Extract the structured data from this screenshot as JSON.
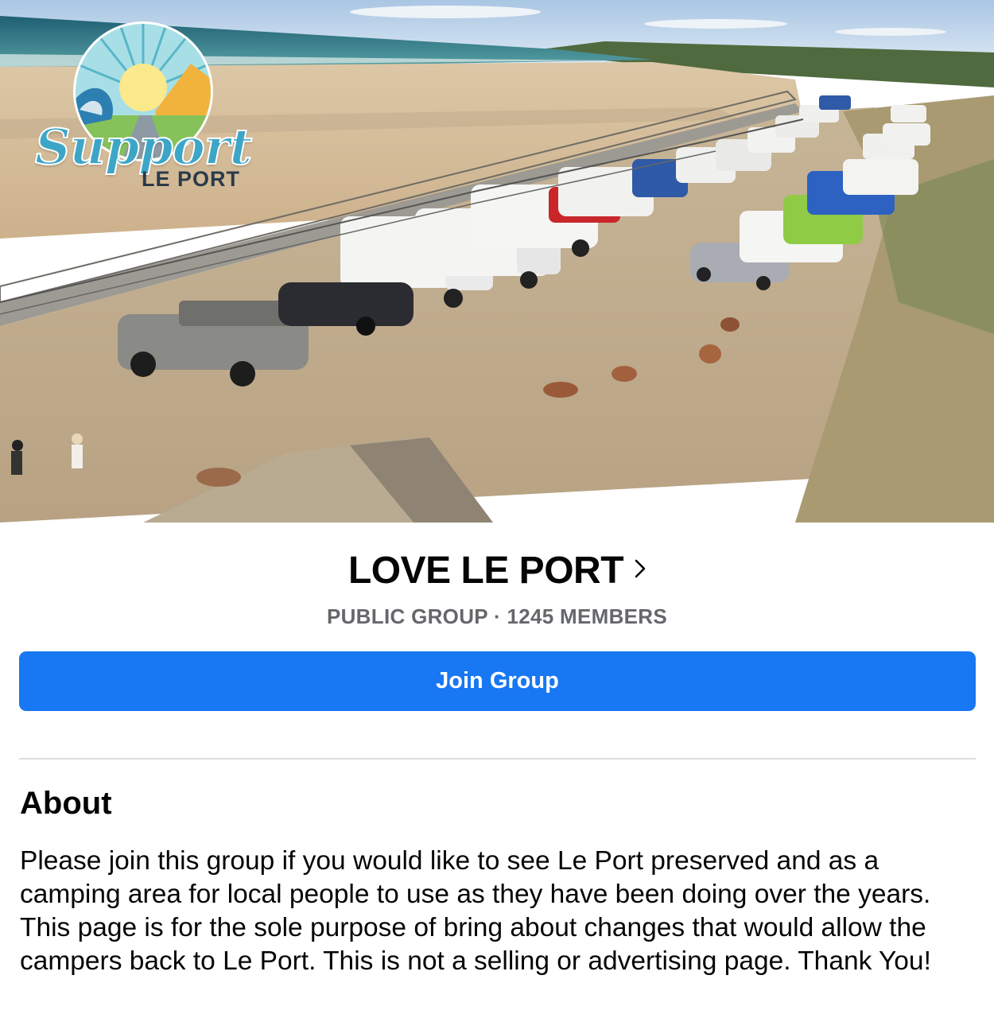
{
  "cover": {
    "logo": {
      "script_text": "Support",
      "sub_text": "LE PORT"
    }
  },
  "group": {
    "name": "LOVE LE PORT",
    "meta": "PUBLIC GROUP · 1245 MEMBERS",
    "join_label": "Join Group"
  },
  "about": {
    "heading": "About",
    "body": "Please join this group if you would like to see Le Port preserved and as a camping area for local people to use as they have been doing over the years. This page is for the sole purpose of bring about changes that would allow the campers back to Le Port. This is not a selling or advertising page. Thank You!"
  },
  "colors": {
    "accent": "#1877f2",
    "meta_text": "#65676b",
    "divider": "#dadde1"
  },
  "icons": {
    "title_chevron": "chevron-right-icon"
  }
}
